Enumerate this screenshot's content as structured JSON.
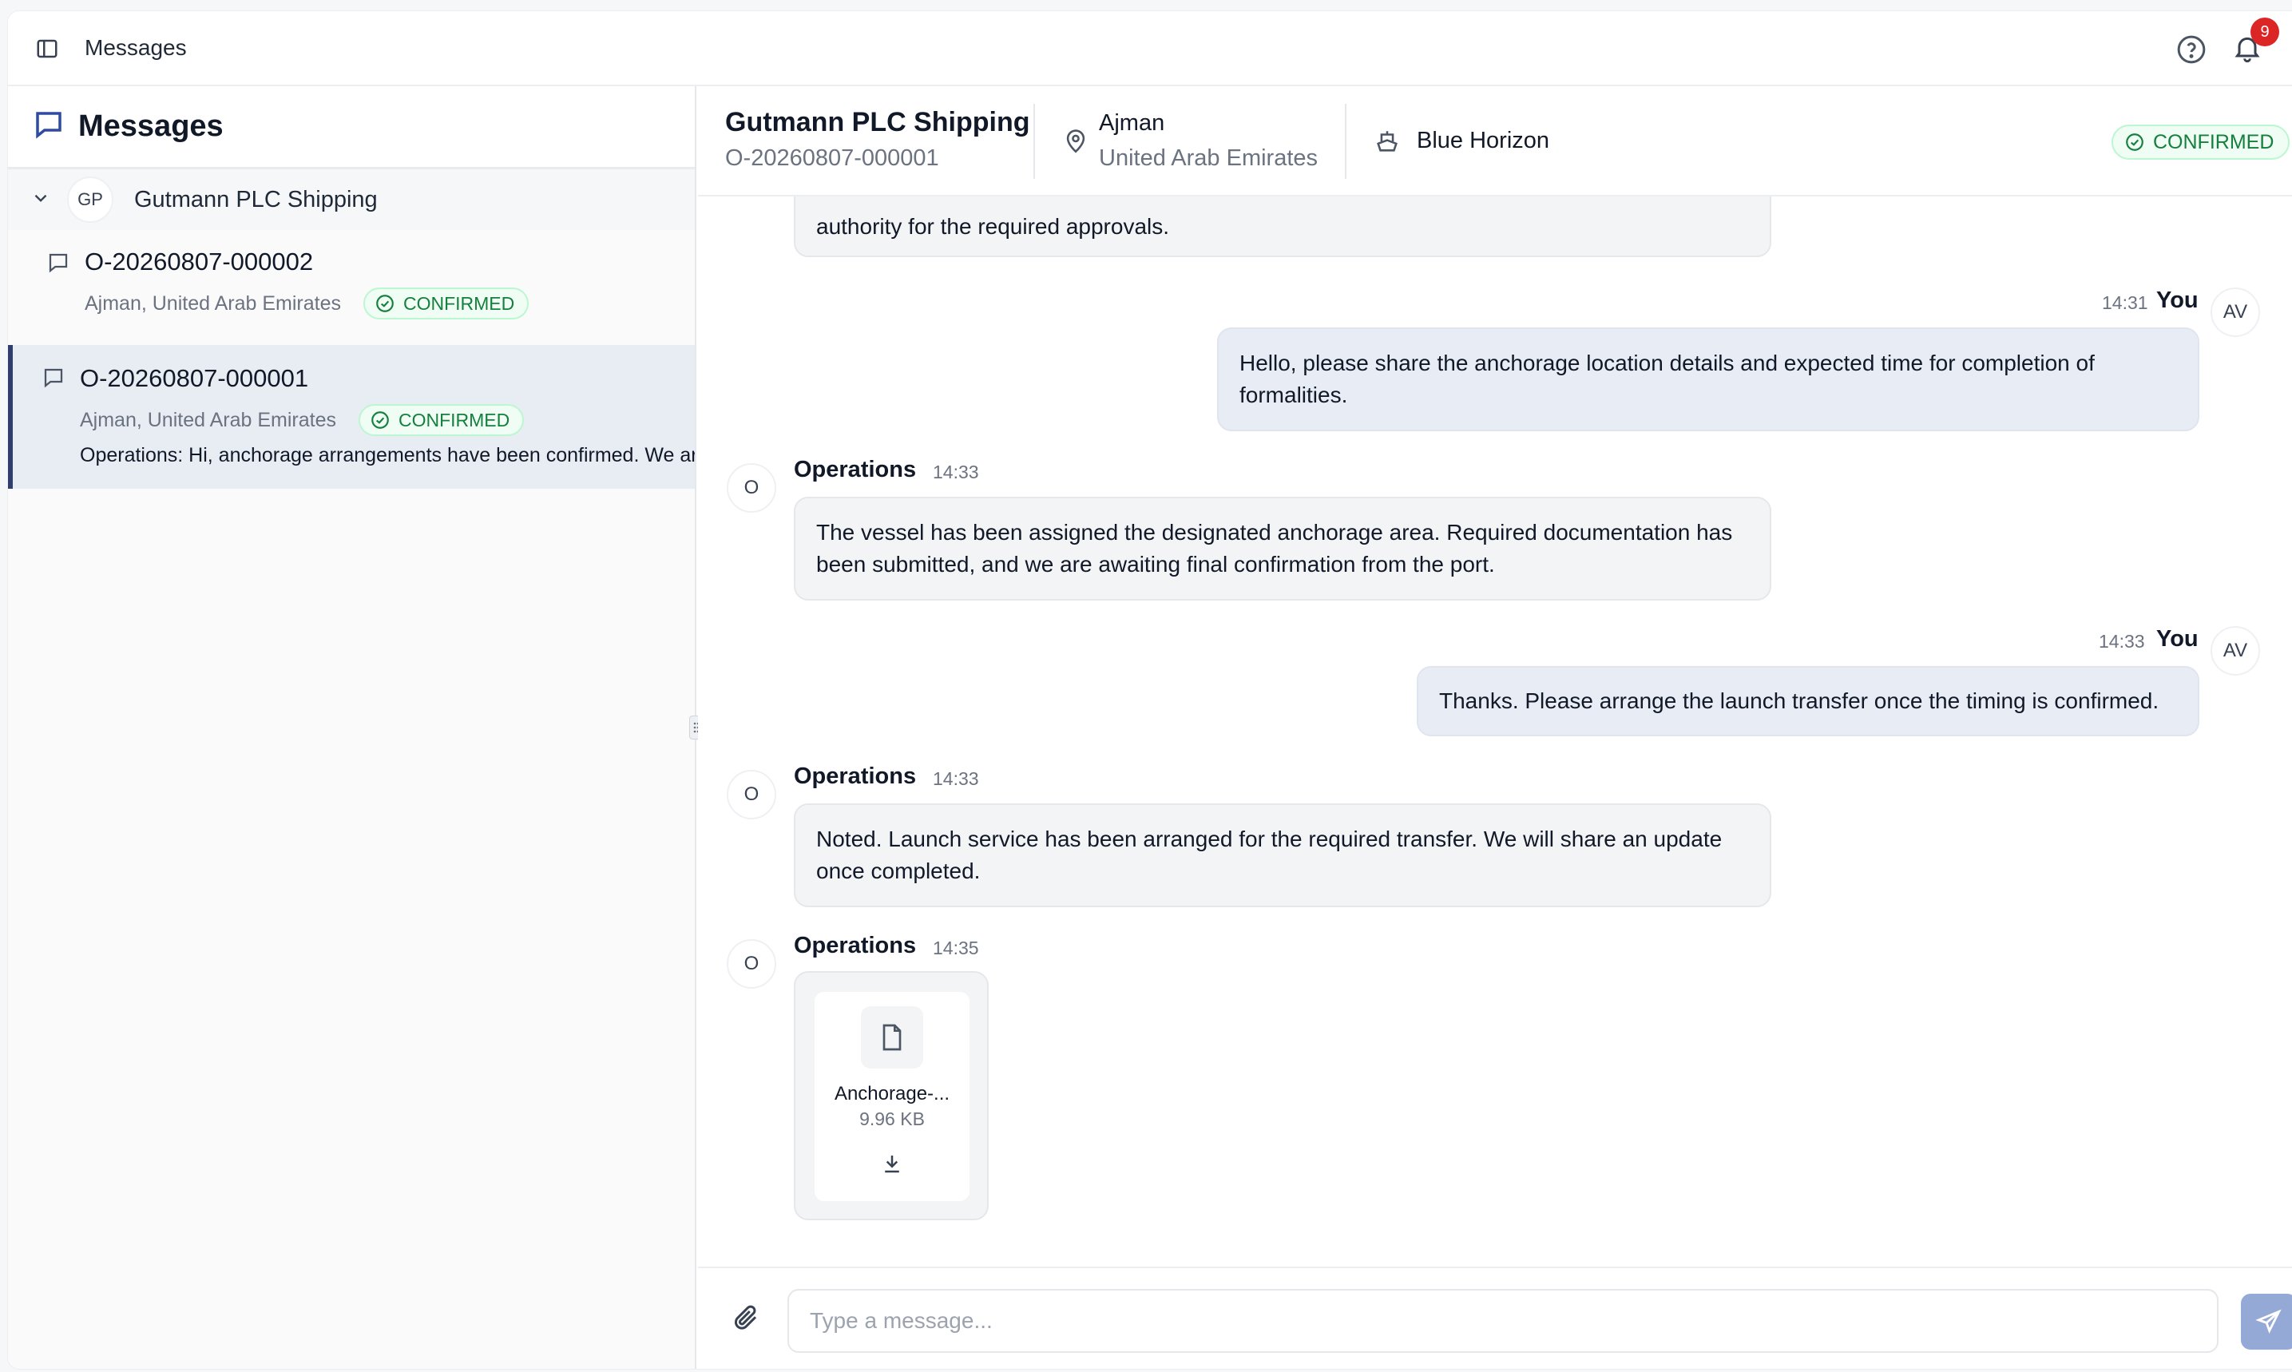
{
  "topbar": {
    "title": "Messages",
    "notification_count": "9"
  },
  "sidebar": {
    "title": "Messages",
    "group": {
      "initials": "GP",
      "name": "Gutmann PLC Shipping"
    },
    "conversations": [
      {
        "id": "O-20260807-000002",
        "location": "Ajman, United Arab Emirates",
        "status": "CONFIRMED",
        "preview": ""
      },
      {
        "id": "O-20260807-000001",
        "location": "Ajman, United Arab Emirates",
        "status": "CONFIRMED",
        "preview": "Operations: Hi, anchorage arrangements have been confirmed. We are"
      }
    ]
  },
  "chat_header": {
    "company": "Gutmann PLC Shipping",
    "order_id": "O-20260807-000001",
    "city": "Ajman",
    "country": "United Arab Emirates",
    "vessel": "Blue Horizon",
    "status": "CONFIRMED"
  },
  "messages": [
    {
      "text_lines": [
        "authority for the required approvals."
      ]
    },
    {
      "sender": "You",
      "time": "14:31",
      "avatar": "AV",
      "text_lines": [
        "Hello, please share the anchorage location details and expected time for completion of",
        "formalities."
      ]
    },
    {
      "sender": "Operations",
      "time": "14:33",
      "avatar": "O",
      "text_lines": [
        "The vessel has been assigned the designated anchorage area. Required documentation has",
        "been submitted, and we are awaiting final confirmation from the port."
      ]
    },
    {
      "sender": "You",
      "time": "14:33",
      "avatar": "AV",
      "text_lines": [
        "Thanks. Please arrange the launch transfer once the timing is confirmed."
      ]
    },
    {
      "sender": "Operations",
      "time": "14:33",
      "avatar": "O",
      "text_lines": [
        "Noted. Launch service has been arranged for the required transfer. We will share an update",
        "once completed."
      ]
    },
    {
      "sender": "Operations",
      "time": "14:35",
      "avatar": "O",
      "attachment": {
        "name": "Anchorage-...",
        "size": "9.96 KB"
      }
    }
  ],
  "composer": {
    "placeholder": "Type a message..."
  },
  "colors": {
    "accent": "#2f3f6c",
    "confirmed_green": "#15803d",
    "badge_red": "#dc2626",
    "send_button": "#94a9d6"
  },
  "icons": [
    "sidebar-toggle-icon",
    "help-icon",
    "bell-icon",
    "chat-bubble-icon",
    "chevron-down-icon",
    "check-circle-icon",
    "map-pin-icon",
    "ship-icon",
    "file-icon",
    "download-icon",
    "paperclip-icon",
    "send-icon",
    "drag-handle-icon"
  ]
}
